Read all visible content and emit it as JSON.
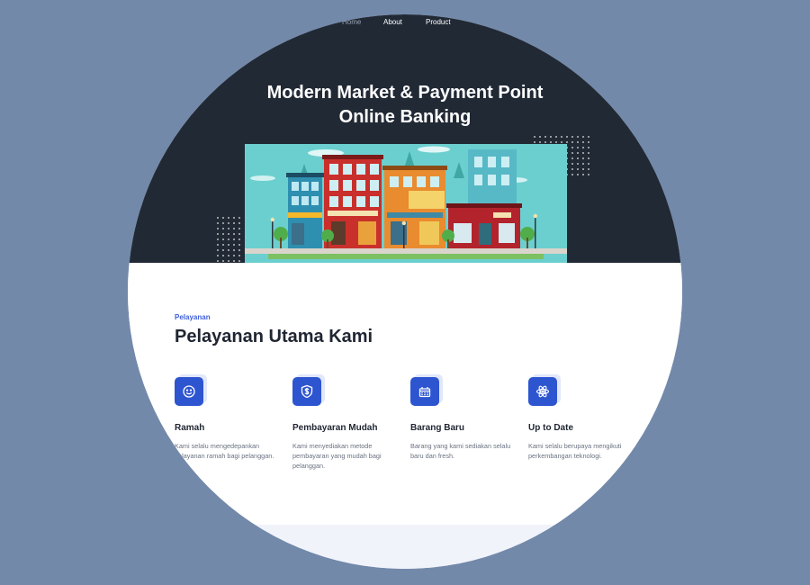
{
  "nav": {
    "items": [
      "Home",
      "About",
      "Product"
    ]
  },
  "hero": {
    "title_line1": "Modern Market & Payment Point",
    "title_line2": "Online Banking"
  },
  "services": {
    "eyebrow": "Pelayanan",
    "title": "Pelayanan Utama Kami",
    "cards": [
      {
        "icon": "smile-icon",
        "title": "Ramah",
        "text": "Kami selalu mengedepankan pelayanan ramah bagi pelanggan."
      },
      {
        "icon": "dollar-shield-icon",
        "title": "Pembayaran Mudah",
        "text": "Kami menyediakan metode pembayaran yang mudah bagi pelanggan."
      },
      {
        "icon": "basket-icon",
        "title": "Barang Baru",
        "text": "Barang yang kami sediakan selalu baru dan fresh."
      },
      {
        "icon": "atom-icon",
        "title": "Up to Date",
        "text": "Kami selalu berupaya mengikuti perkembangan teknologi."
      }
    ]
  },
  "colors": {
    "background": "#7289aa",
    "hero": "#212935",
    "accent": "#2e55d0"
  }
}
